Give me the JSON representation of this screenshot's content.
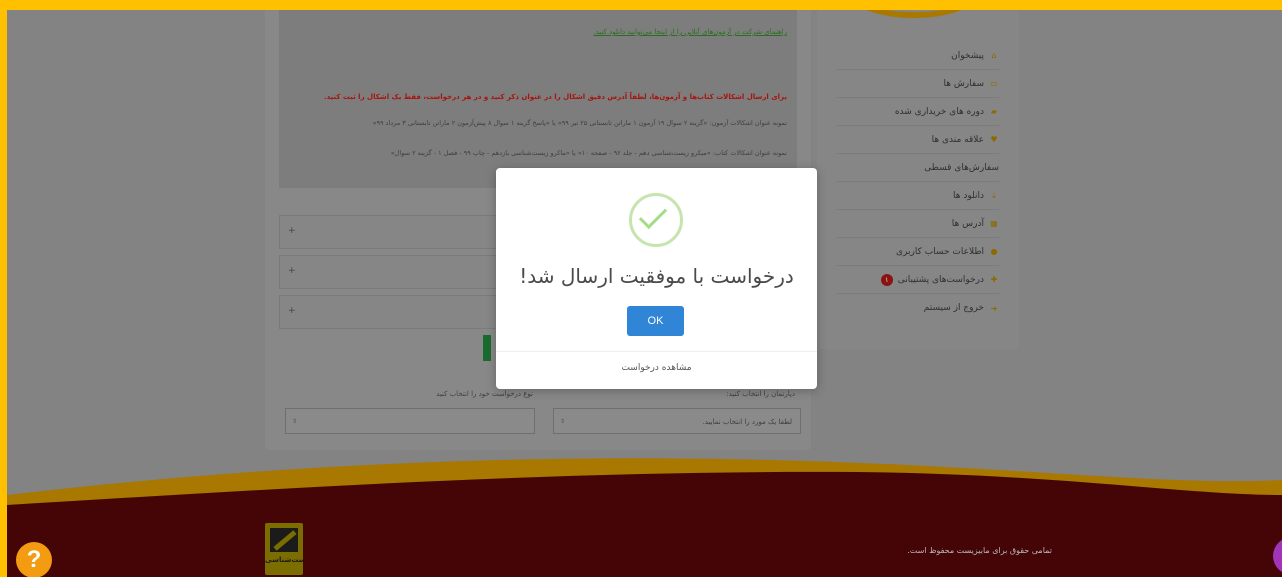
{
  "info": {
    "guide_link": "راهنمای شرکت در آزمون‌های آنلاین را از اینجا می‌توانید دانلود کنید.",
    "warning": "برای ارسال اشکالات کتاب‌ها و آزمون‌ها، لطفاً آدرس دقیق اشکال را در عنوان ذکر کنید و در هر درخواست، فقط یک اشکال را ثبت کنید.",
    "example_exam": "نمونه عنوان اشکالات آزمون: «گزینه ۲ سوال ۱۹ آزمون ۱ ماراتن تابستانی ۲۵ تیر ۹۹» یا «پاسخ گزینه ۱ سوال ۸ پیش‌آزمون ۲ ماراتن تابستانی ۳ مرداد ۹۹»",
    "example_book": "نمونه عنوان اشکالات کتاب: «میکرو زیست‌شناسی دهم - جلد ۹۶ - صفحه ۱۰» یا «ماکرو زیست‌شناسی یازدهم - چاپ ۹۹ - فصل ۱ - گزینه ۲ سوال»"
  },
  "accordion": [
    "+",
    "+",
    "+"
  ],
  "form": {
    "department_label": "دپارتمان را انتخاب کنید:",
    "department_value": "لطفا یک مورد را انتخاب نمایید.",
    "type_label": "نوع درخواست خود را انتخاب کنید",
    "type_value": "",
    "chevron": "⇕"
  },
  "sidebar": {
    "items": [
      {
        "label": "پیشخوان",
        "icon": "⌂"
      },
      {
        "label": "سفارش ها",
        "icon": "▭"
      },
      {
        "label": "دوره های خریداری شده",
        "icon": "▰"
      },
      {
        "label": "علاقه مندی ها",
        "icon": "♥"
      },
      {
        "label": "سفارش‌های قسطی",
        "icon": ""
      },
      {
        "label": "دانلود ها",
        "icon": "⤓"
      },
      {
        "label": "آدرس ها",
        "icon": "▦"
      },
      {
        "label": "اطلاعات حساب کاربری",
        "icon": "●"
      },
      {
        "label": "درخواست‌های پشتیبانی",
        "icon": "✚",
        "badge": "۱"
      },
      {
        "label": "خروج از سیستم",
        "icon": "➜"
      }
    ]
  },
  "footer": {
    "copyright": "تمامی حقوق برای مابیزیست محفوظ است.",
    "logo_text": "زیست‌شناسی"
  },
  "modal": {
    "title": "درخواست با موفقیت ارسال شد!",
    "ok_label": "OK",
    "view_request": "مشاهده درخواست"
  },
  "help": {
    "label": "?"
  },
  "colors": {
    "frame": "#ffc000",
    "overlay_bg": "#838383",
    "footer": "#450506",
    "ok_button": "#3085d6",
    "success": "#a5dc86",
    "help_fab": "#f39c12",
    "chat_fab": "#a035b8"
  }
}
